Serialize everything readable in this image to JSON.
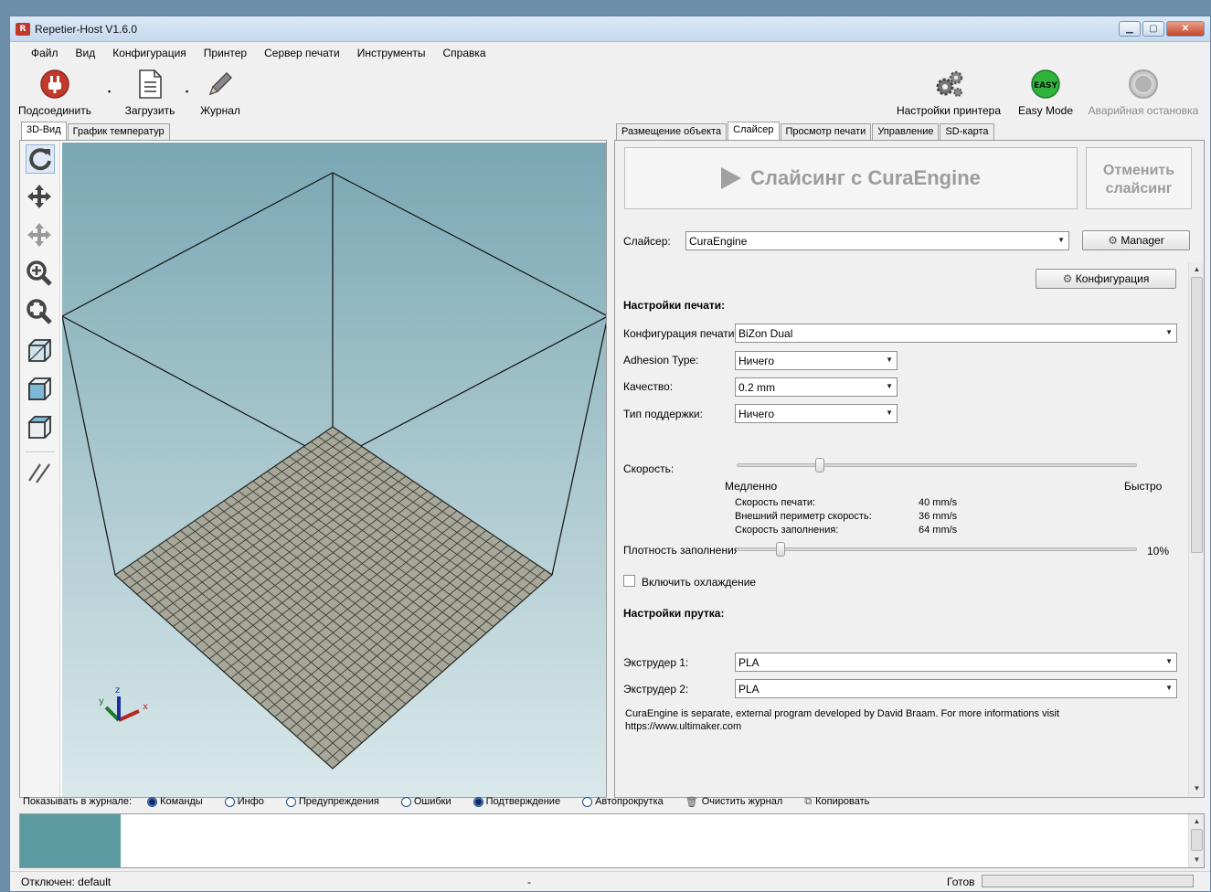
{
  "window": {
    "title": "Repetier-Host V1.6.0",
    "icon_text": "R"
  },
  "menu": [
    "Файл",
    "Вид",
    "Конфигурация",
    "Принтер",
    "Сервер печати",
    "Инструменты",
    "Справка"
  ],
  "toolbar": {
    "connect": "Подсоединить",
    "load": "Загрузить",
    "log": "Журнал",
    "printer_settings": "Настройки принтера",
    "easy_mode": "Easy Mode",
    "easy_badge": "EASY",
    "emergency_stop": "Аварийная остановка"
  },
  "left_tabs": [
    "3D-Вид",
    "График температур"
  ],
  "right_tabs": [
    "Размещение объекта",
    "Слайсер",
    "Просмотр печати",
    "Управление",
    "SD-карта"
  ],
  "slicer": {
    "slice_button": "Слайсинг с CuraEngine",
    "cancel_line1": "Отменить",
    "cancel_line2": "слайсинг",
    "slicer_label": "Слайсер:",
    "slicer_value": "CuraEngine",
    "manager_button": "Manager",
    "config_button": "Конфигурация",
    "print_settings_heading": "Настройки печати:",
    "print_config_label": "Конфигурация печати:",
    "print_config_value": "BiZon Dual",
    "adhesion_label": "Adhesion Type:",
    "adhesion_value": "Ничего",
    "quality_label": "Качество:",
    "quality_value": "0.2 mm",
    "support_label": "Тип поддержки:",
    "support_value": "Ничего",
    "speed_label": "Скорость:",
    "speed_slow": "Медленно",
    "speed_fast": "Быстро",
    "speed_level": 0.2,
    "print_speed_label": "Скорость печати:",
    "print_speed_value": "40 mm/s",
    "outer_speed_label": "Внешний периметр скорость:",
    "outer_speed_value": "36 mm/s",
    "infill_speed_label": "Скорость заполнения:",
    "infill_speed_value": "64 mm/s",
    "infill_density_label": "Плотность заполнения",
    "infill_density_value": "10%",
    "infill_density_level": 0.1,
    "cooling_label": "Включить охлаждение",
    "filament_heading": "Настройки прутка:",
    "extruder1_label": "Экструдер 1:",
    "extruder1_value": "PLA",
    "extruder2_label": "Экструдер 2:",
    "extruder2_value": "PLA",
    "info_line1": "CuraEngine is separate, external program developed by David Braam. For more informations visit",
    "info_line2": "https://www.ultimaker.com"
  },
  "log": {
    "show_label": "Показывать в журнале:",
    "commands": "Команды",
    "info": "Инфо",
    "warnings": "Предупреждения",
    "errors": "Ошибки",
    "ack": "Подтверждение",
    "autoscroll": "Автопрокрутка",
    "clear": "Очистить журнал",
    "copy": "Копировать"
  },
  "status": {
    "left": "Отключен: default",
    "middle": "-",
    "right": "Готов"
  },
  "colors": {
    "accent_green": "#2fb33a",
    "connect_red": "#c0392b",
    "viewport_top": "#79a7b3",
    "bed": "#a8a89a"
  }
}
